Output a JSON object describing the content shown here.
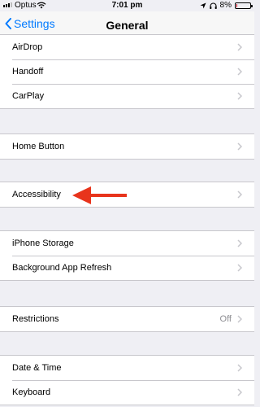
{
  "status": {
    "carrier": "Optus",
    "time": "7:01 pm",
    "battery_percent": "8%",
    "battery_level": 0.08,
    "battery_color": "#d0021b"
  },
  "nav": {
    "back_label": "Settings",
    "title": "General"
  },
  "groups": [
    {
      "rows": [
        {
          "label": "AirDrop"
        },
        {
          "label": "Handoff"
        },
        {
          "label": "CarPlay"
        }
      ]
    },
    {
      "rows": [
        {
          "label": "Home Button"
        }
      ]
    },
    {
      "rows": [
        {
          "label": "Accessibility"
        }
      ]
    },
    {
      "rows": [
        {
          "label": "iPhone Storage"
        },
        {
          "label": "Background App Refresh"
        }
      ]
    },
    {
      "rows": [
        {
          "label": "Restrictions",
          "value": "Off"
        }
      ]
    },
    {
      "rows": [
        {
          "label": "Date & Time"
        },
        {
          "label": "Keyboard"
        }
      ]
    }
  ],
  "colors": {
    "accent": "#007aff",
    "annotation_arrow": "#e8341c",
    "background": "#efeff4"
  }
}
